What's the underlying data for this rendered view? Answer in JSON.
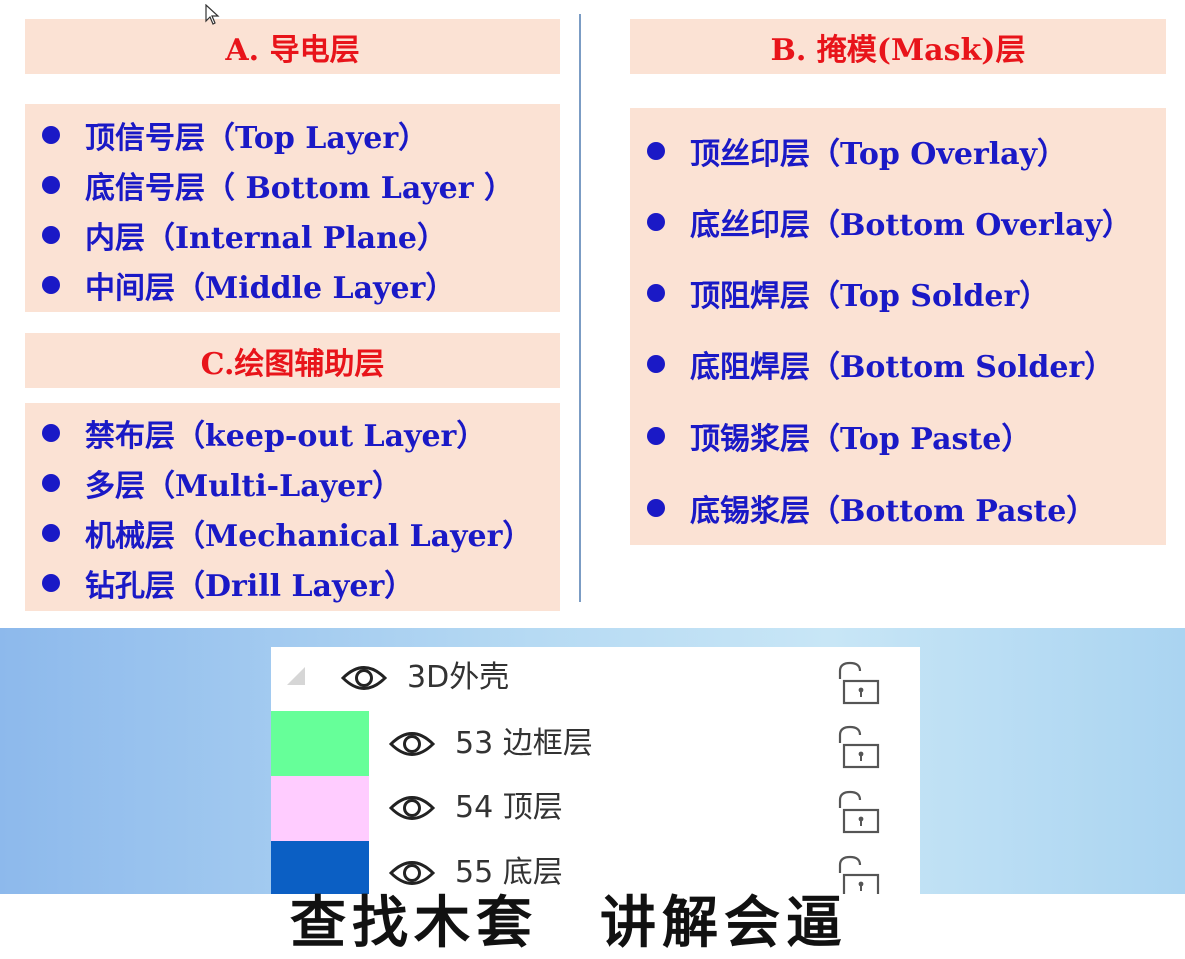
{
  "slide": {
    "section_a": {
      "title": "A. 导电层",
      "items": [
        "顶信号层（Top Layer）",
        "底信号层（ Bottom Layer ）",
        "内层（Internal Plane）",
        "中间层（Middle Layer）"
      ]
    },
    "section_b": {
      "title": "B. 掩模(Mask)层",
      "items": [
        "顶丝印层（Top Overlay）",
        "底丝印层（Bottom Overlay）",
        "顶阻焊层（Top Solder）",
        "底阻焊层（Bottom Solder）",
        "顶锡浆层（Top Paste）",
        "底锡浆层（Bottom Paste）"
      ]
    },
    "section_c": {
      "title": "C.绘图辅助层",
      "items": [
        "禁布层（keep-out Layer）",
        "多层（Multi-Layer）",
        "机械层（Mechanical Layer）",
        "钻孔层（Drill Layer）"
      ]
    }
  },
  "layer_panel": {
    "group": {
      "label": "3D外壳",
      "icons": [
        "collapse-triangle-icon",
        "eye-icon",
        "unlock-icon"
      ]
    },
    "rows": [
      {
        "label": "53 边框层",
        "color": "#66ff99"
      },
      {
        "label": "54 顶层",
        "color": "#ffccff"
      },
      {
        "label": "55 底层",
        "color": "#0b5fc4"
      }
    ]
  },
  "overlay_caption": "查找木套　讲解会逼"
}
